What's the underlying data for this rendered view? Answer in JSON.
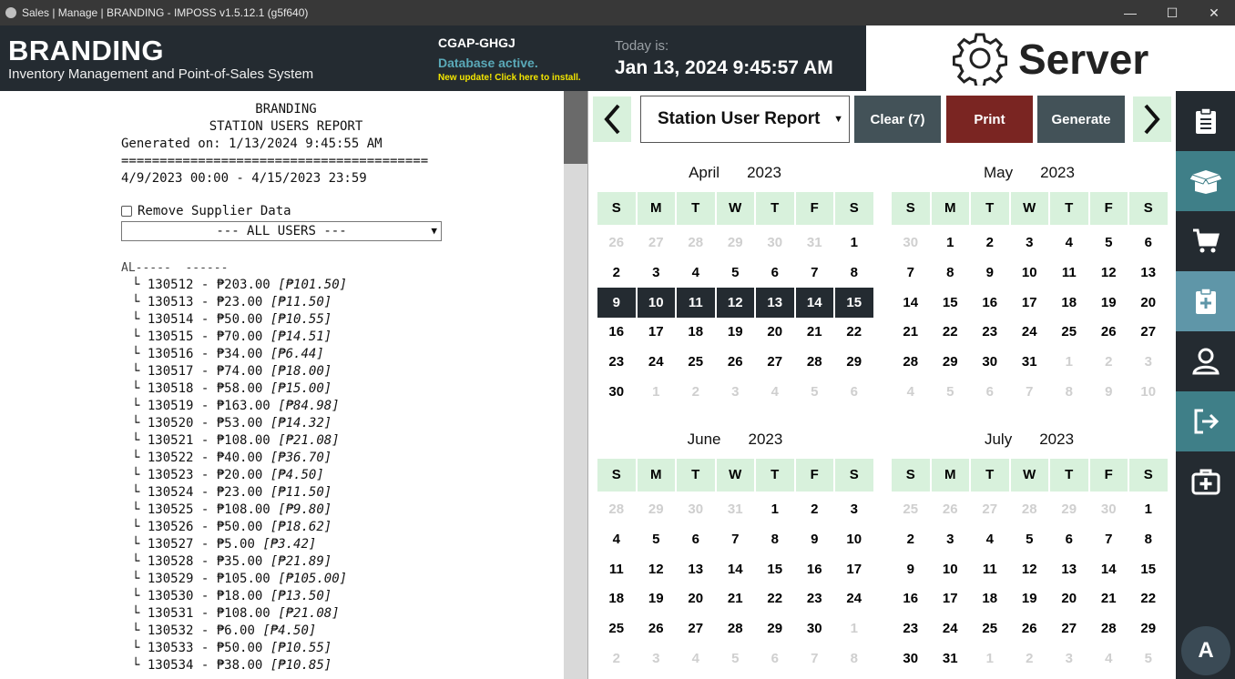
{
  "window": {
    "title": "Sales | Manage | BRANDING - IMPOSS v1.5.12.1 (g5f640)",
    "minimize": "—",
    "maximize": "☐",
    "close": "✕"
  },
  "header": {
    "brand": "BRANDING",
    "subtitle": "Inventory Management and Point-of-Sales System",
    "station": "CGAP-GHGJ",
    "db_status": "Database active.",
    "update_notice": "New update! Click here to install.",
    "today_label": "Today is:",
    "today_value": "Jan 13, 2024 9:45:57 AM",
    "server_label": "Server"
  },
  "report": {
    "line1": "BRANDING",
    "line2": "STATION USERS REPORT",
    "generated": "Generated on: 1/13/2024 9:45:55 AM",
    "separator": "========================================",
    "range": "4/9/2023 00:00 - 4/15/2023 23:59",
    "remove_supplier": "Remove Supplier Data",
    "user_filter": "--- ALL USERS ---",
    "group_header": "AL-----  ------",
    "transactions": [
      {
        "id": "130512",
        "amount": "₱203.00",
        "sub": "[₱101.50]"
      },
      {
        "id": "130513",
        "amount": "₱23.00",
        "sub": "[₱11.50]"
      },
      {
        "id": "130514",
        "amount": "₱50.00",
        "sub": "[₱10.55]"
      },
      {
        "id": "130515",
        "amount": "₱70.00",
        "sub": "[₱14.51]"
      },
      {
        "id": "130516",
        "amount": "₱34.00",
        "sub": "[₱6.44]"
      },
      {
        "id": "130517",
        "amount": "₱74.00",
        "sub": "[₱18.00]"
      },
      {
        "id": "130518",
        "amount": "₱58.00",
        "sub": "[₱15.00]"
      },
      {
        "id": "130519",
        "amount": "₱163.00",
        "sub": "[₱84.98]"
      },
      {
        "id": "130520",
        "amount": "₱53.00",
        "sub": "[₱14.32]"
      },
      {
        "id": "130521",
        "amount": "₱108.00",
        "sub": "[₱21.08]"
      },
      {
        "id": "130522",
        "amount": "₱40.00",
        "sub": "[₱36.70]"
      },
      {
        "id": "130523",
        "amount": "₱20.00",
        "sub": "[₱4.50]"
      },
      {
        "id": "130524",
        "amount": "₱23.00",
        "sub": "[₱11.50]"
      },
      {
        "id": "130525",
        "amount": "₱108.00",
        "sub": "[₱9.80]"
      },
      {
        "id": "130526",
        "amount": "₱50.00",
        "sub": "[₱18.62]"
      },
      {
        "id": "130527",
        "amount": "₱5.00",
        "sub": "[₱3.42]"
      },
      {
        "id": "130528",
        "amount": "₱35.00",
        "sub": "[₱21.89]"
      },
      {
        "id": "130529",
        "amount": "₱105.00",
        "sub": "[₱105.00]"
      },
      {
        "id": "130530",
        "amount": "₱18.00",
        "sub": "[₱13.50]"
      },
      {
        "id": "130531",
        "amount": "₱108.00",
        "sub": "[₱21.08]"
      },
      {
        "id": "130532",
        "amount": "₱6.00",
        "sub": "[₱4.50]"
      },
      {
        "id": "130533",
        "amount": "₱50.00",
        "sub": "[₱10.55]"
      },
      {
        "id": "130534",
        "amount": "₱38.00",
        "sub": "[₱10.85]"
      }
    ]
  },
  "toolbar": {
    "prev": "‹",
    "next": "›",
    "report_type": "Station User Report",
    "clear_label": "Clear (7)",
    "print_label": "Print",
    "generate_label": "Generate",
    "colors": {
      "clear": "#435258",
      "print": "#7a2522",
      "generate": "#435258"
    }
  },
  "calendar": {
    "weekdays": [
      "S",
      "M",
      "T",
      "W",
      "T",
      "F",
      "S"
    ],
    "months": [
      {
        "month": "April",
        "year": "2023",
        "days": [
          [
            "26",
            "27",
            "28",
            "29",
            "30",
            "31",
            "1"
          ],
          [
            "2",
            "3",
            "4",
            "5",
            "6",
            "7",
            "8"
          ],
          [
            "9",
            "10",
            "11",
            "12",
            "13",
            "14",
            "15"
          ],
          [
            "16",
            "17",
            "18",
            "19",
            "20",
            "21",
            "22"
          ],
          [
            "23",
            "24",
            "25",
            "26",
            "27",
            "28",
            "29"
          ],
          [
            "30",
            "1",
            "2",
            "3",
            "4",
            "5",
            "6"
          ]
        ],
        "other": [
          [
            1,
            1,
            1,
            1,
            1,
            1,
            0
          ],
          [
            0,
            0,
            0,
            0,
            0,
            0,
            0
          ],
          [
            0,
            0,
            0,
            0,
            0,
            0,
            0
          ],
          [
            0,
            0,
            0,
            0,
            0,
            0,
            0
          ],
          [
            0,
            0,
            0,
            0,
            0,
            0,
            0
          ],
          [
            0,
            1,
            1,
            1,
            1,
            1,
            1
          ]
        ],
        "selected_row": 2
      },
      {
        "month": "May",
        "year": "2023",
        "days": [
          [
            "30",
            "1",
            "2",
            "3",
            "4",
            "5",
            "6"
          ],
          [
            "7",
            "8",
            "9",
            "10",
            "11",
            "12",
            "13"
          ],
          [
            "14",
            "15",
            "16",
            "17",
            "18",
            "19",
            "20"
          ],
          [
            "21",
            "22",
            "23",
            "24",
            "25",
            "26",
            "27"
          ],
          [
            "28",
            "29",
            "30",
            "31",
            "1",
            "2",
            "3"
          ],
          [
            "4",
            "5",
            "6",
            "7",
            "8",
            "9",
            "10"
          ]
        ],
        "other": [
          [
            1,
            0,
            0,
            0,
            0,
            0,
            0
          ],
          [
            0,
            0,
            0,
            0,
            0,
            0,
            0
          ],
          [
            0,
            0,
            0,
            0,
            0,
            0,
            0
          ],
          [
            0,
            0,
            0,
            0,
            0,
            0,
            0
          ],
          [
            0,
            0,
            0,
            0,
            1,
            1,
            1
          ],
          [
            1,
            1,
            1,
            1,
            1,
            1,
            1
          ]
        ],
        "selected_row": -1
      },
      {
        "month": "June",
        "year": "2023",
        "days": [
          [
            "28",
            "29",
            "30",
            "31",
            "1",
            "2",
            "3"
          ],
          [
            "4",
            "5",
            "6",
            "7",
            "8",
            "9",
            "10"
          ],
          [
            "11",
            "12",
            "13",
            "14",
            "15",
            "16",
            "17"
          ],
          [
            "18",
            "19",
            "20",
            "21",
            "22",
            "23",
            "24"
          ],
          [
            "25",
            "26",
            "27",
            "28",
            "29",
            "30",
            "1"
          ],
          [
            "2",
            "3",
            "4",
            "5",
            "6",
            "7",
            "8"
          ]
        ],
        "other": [
          [
            1,
            1,
            1,
            1,
            0,
            0,
            0
          ],
          [
            0,
            0,
            0,
            0,
            0,
            0,
            0
          ],
          [
            0,
            0,
            0,
            0,
            0,
            0,
            0
          ],
          [
            0,
            0,
            0,
            0,
            0,
            0,
            0
          ],
          [
            0,
            0,
            0,
            0,
            0,
            0,
            1
          ],
          [
            1,
            1,
            1,
            1,
            1,
            1,
            1
          ]
        ],
        "selected_row": -1
      },
      {
        "month": "July",
        "year": "2023",
        "days": [
          [
            "25",
            "26",
            "27",
            "28",
            "29",
            "30",
            "1"
          ],
          [
            "2",
            "3",
            "4",
            "5",
            "6",
            "7",
            "8"
          ],
          [
            "9",
            "10",
            "11",
            "12",
            "13",
            "14",
            "15"
          ],
          [
            "16",
            "17",
            "18",
            "19",
            "20",
            "21",
            "22"
          ],
          [
            "23",
            "24",
            "25",
            "26",
            "27",
            "28",
            "29"
          ],
          [
            "30",
            "31",
            "1",
            "2",
            "3",
            "4",
            "5"
          ]
        ],
        "other": [
          [
            1,
            1,
            1,
            1,
            1,
            1,
            0
          ],
          [
            0,
            0,
            0,
            0,
            0,
            0,
            0
          ],
          [
            0,
            0,
            0,
            0,
            0,
            0,
            0
          ],
          [
            0,
            0,
            0,
            0,
            0,
            0,
            0
          ],
          [
            0,
            0,
            0,
            0,
            0,
            0,
            0
          ],
          [
            0,
            0,
            1,
            1,
            1,
            1,
            1
          ]
        ],
        "selected_row": -1
      }
    ]
  },
  "sidebar": {
    "items": [
      {
        "icon": "clipboard-icon"
      },
      {
        "icon": "open-box-icon"
      },
      {
        "icon": "cart-icon"
      },
      {
        "icon": "clipboard-plus-icon"
      },
      {
        "icon": "user-icon"
      },
      {
        "icon": "logout-icon"
      },
      {
        "icon": "first-aid-kit-icon"
      }
    ],
    "avatar": "A"
  }
}
